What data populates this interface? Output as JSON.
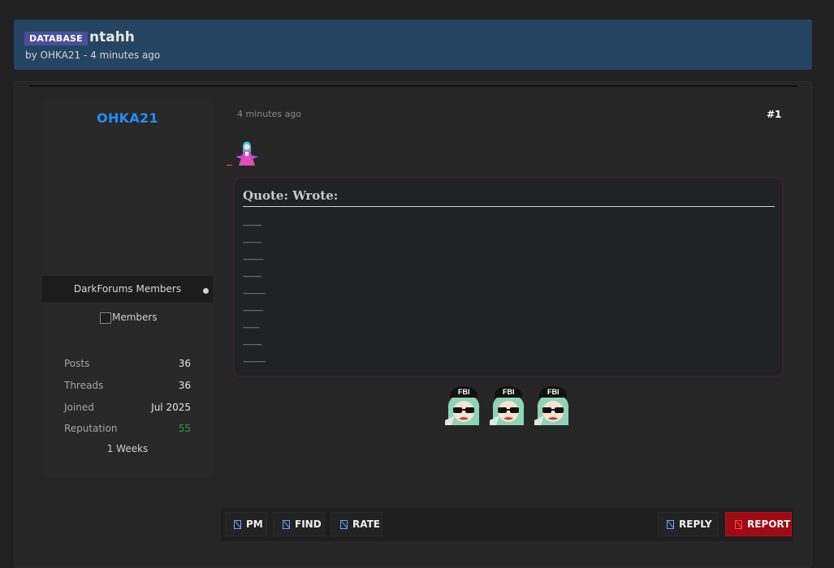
{
  "thread": {
    "prefix": "DATABASE",
    "title": "ntahh",
    "meta": "by OHKA21 - 4 minutes ago"
  },
  "user": {
    "name": "OHKA21",
    "name_color": "#1e90ff",
    "group": "DarkForums Members",
    "group_image_alt": "Members",
    "stats": [
      {
        "label": "Posts",
        "value": "36"
      },
      {
        "label": "Threads",
        "value": "36"
      },
      {
        "label": "Joined",
        "value": "Jul 2025"
      },
      {
        "label": "Reputation",
        "value": "55"
      }
    ],
    "reputation_color": "#2aa02a",
    "time_on_forum": "1 Weeks"
  },
  "post": {
    "date": "4 minutes ago",
    "number": "#1",
    "quote_title": "Quote: Wrote:",
    "quote_lines": [
      "----------",
      "----------",
      "-----------",
      "----------",
      "------------",
      "-----------",
      "---------",
      "----------",
      "------------"
    ],
    "emojis": [
      "fbi-emoji",
      "fbi-emoji",
      "fbi-emoji"
    ]
  },
  "actions": {
    "pm": "PM",
    "find": "FIND",
    "rate": "RATE",
    "reply": "REPLY",
    "report": "REPORT"
  },
  "colors": {
    "header_bg": "#254461",
    "report_bg": "#9d0b14"
  }
}
